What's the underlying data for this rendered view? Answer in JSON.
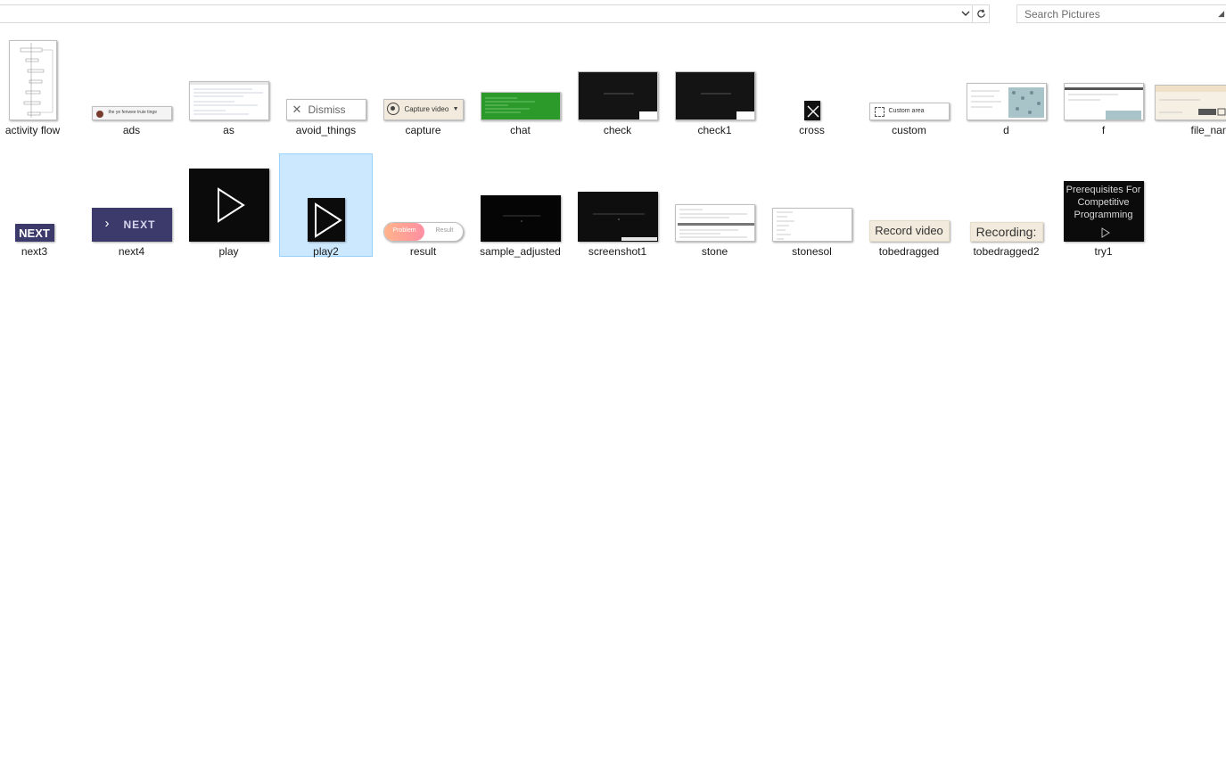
{
  "address_bar": {
    "dropdown_icon": "chevron-down-icon",
    "refresh_icon": "refresh-icon"
  },
  "search": {
    "placeholder": "Search Pictures"
  },
  "files": [
    {
      "name": "activity flow"
    },
    {
      "name": "ads",
      "thumb_text": "the ye fenwee truie tinge"
    },
    {
      "name": "as"
    },
    {
      "name": "avoid_things",
      "thumb_text": "Dismiss"
    },
    {
      "name": "capture",
      "thumb_text": "Capture video"
    },
    {
      "name": "chat"
    },
    {
      "name": "check"
    },
    {
      "name": "check1"
    },
    {
      "name": "cross"
    },
    {
      "name": "custom",
      "thumb_text": "Custom area"
    },
    {
      "name": "d"
    },
    {
      "name": "f"
    },
    {
      "name": "file_name"
    },
    {
      "name": "next3",
      "thumb_text": "NEXT"
    },
    {
      "name": "next4",
      "thumb_text": "NEXT"
    },
    {
      "name": "play"
    },
    {
      "name": "play2"
    },
    {
      "name": "result",
      "thumb_text": "Problem",
      "thumb_text2": "Result"
    },
    {
      "name": "sample_adjusted"
    },
    {
      "name": "screenshot1"
    },
    {
      "name": "stone"
    },
    {
      "name": "stonesol"
    },
    {
      "name": "tobedragged",
      "thumb_text": "Record video"
    },
    {
      "name": "tobedragged2",
      "thumb_text": "Recording:"
    },
    {
      "name": "try1",
      "thumb_text": "Prerequisites For Competitive Programming"
    }
  ],
  "selected_file": "play2",
  "colors": {
    "selection_bg": "#cce8ff",
    "selection_border": "#99d1ff",
    "next_bg": "#3b3a6b"
  }
}
